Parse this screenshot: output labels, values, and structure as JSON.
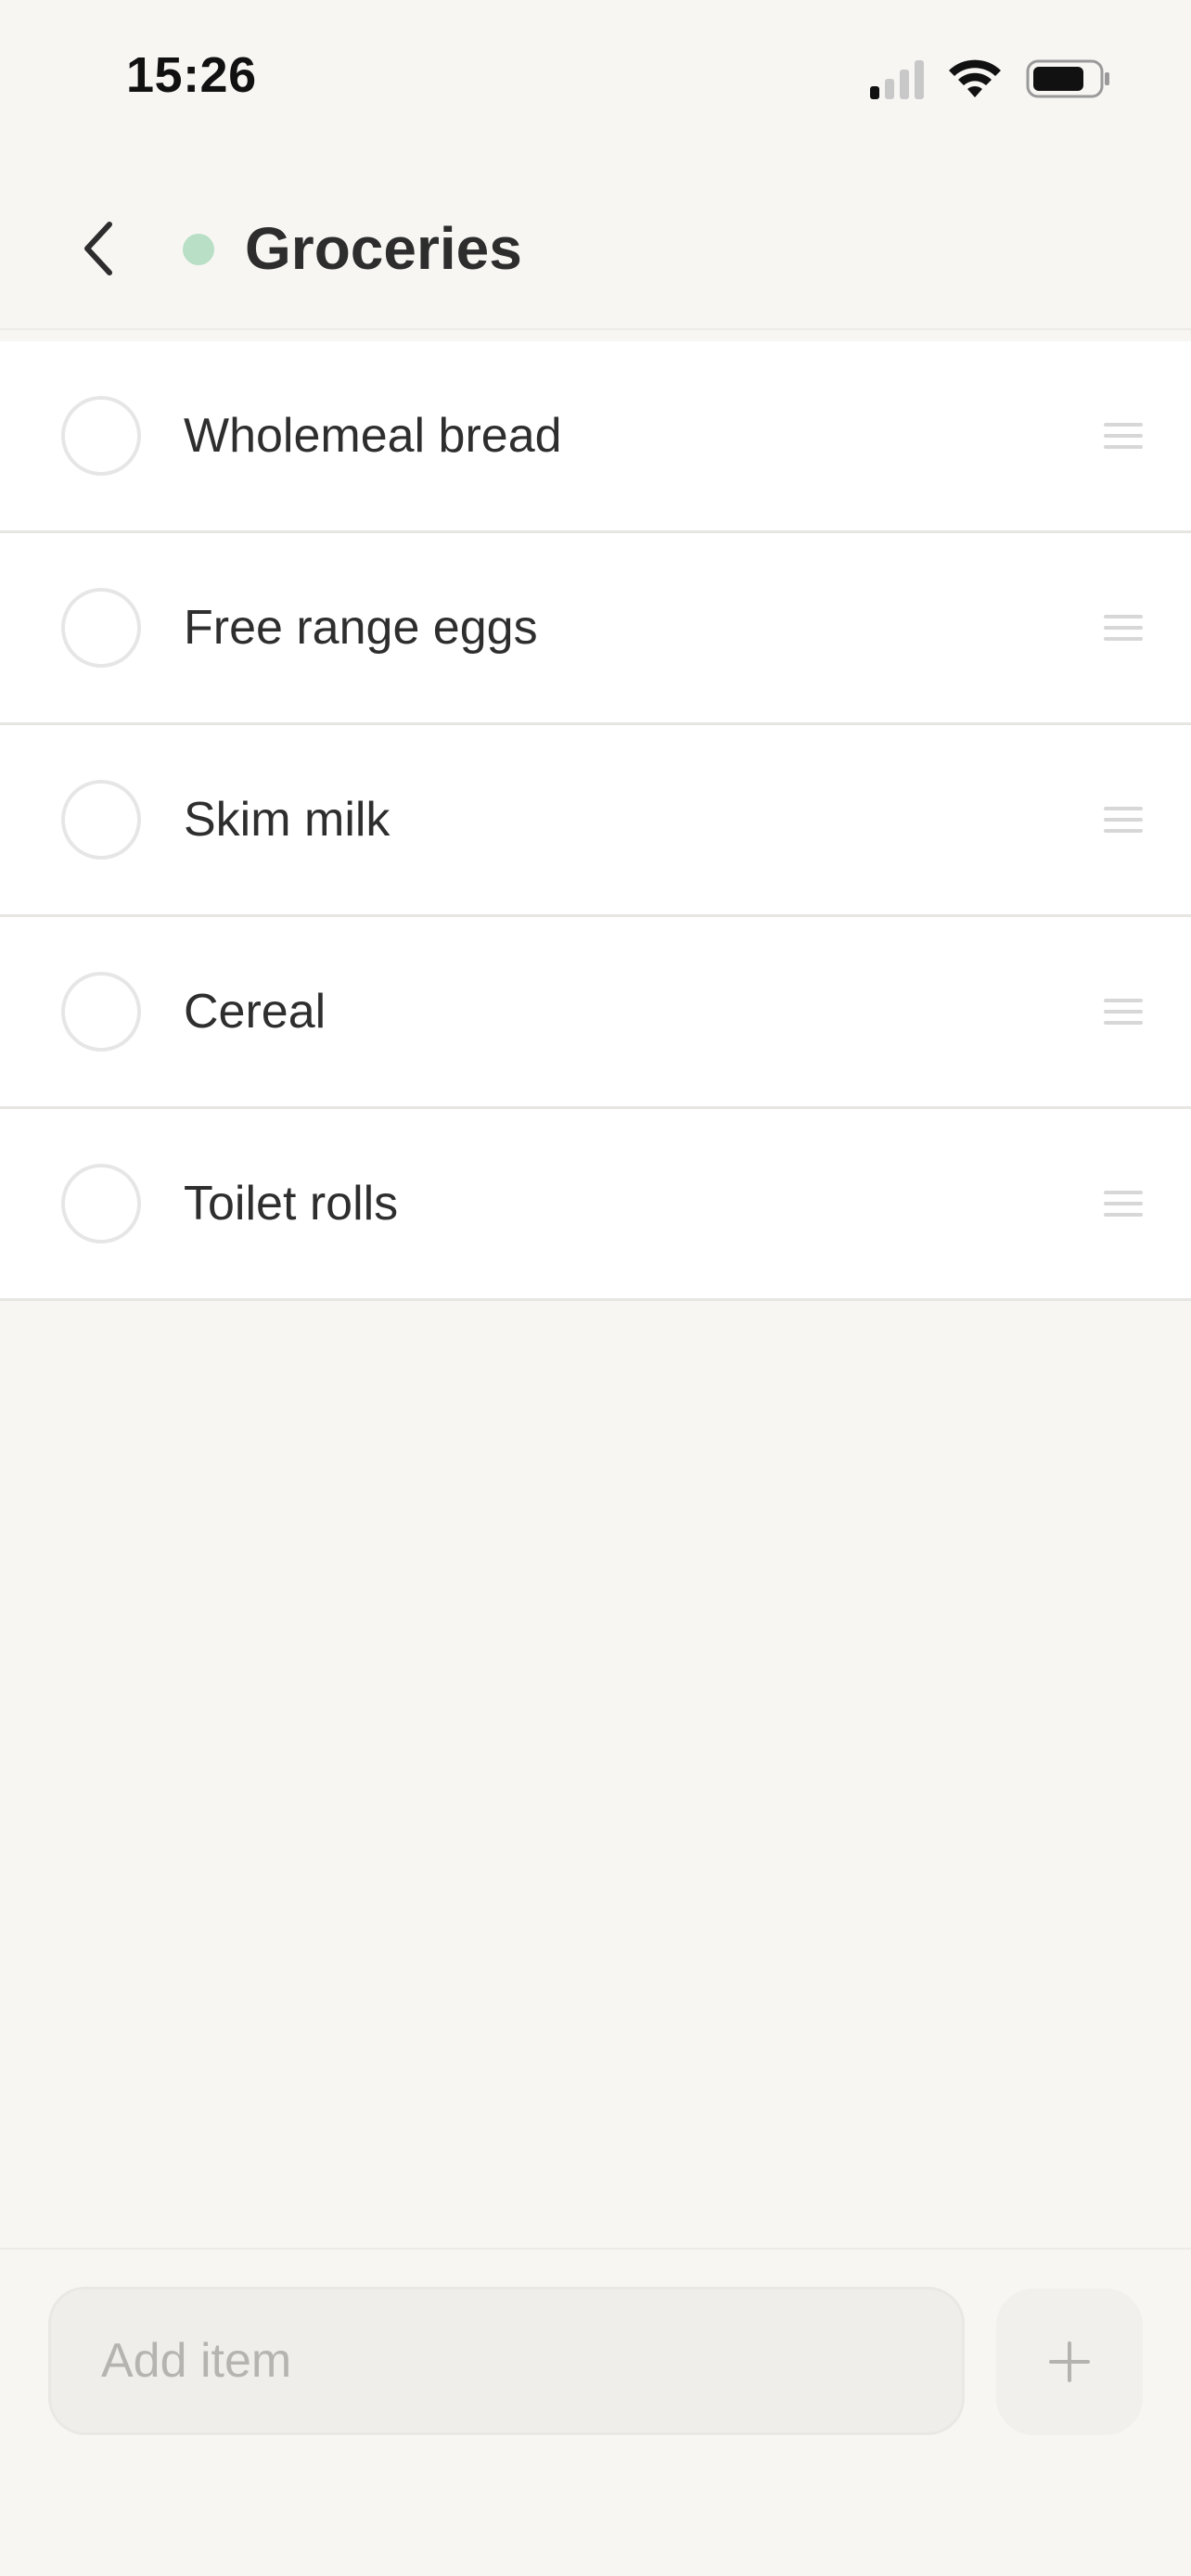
{
  "status_bar": {
    "time": "15:26",
    "icons": [
      "cellular-signal-icon",
      "wifi-icon",
      "battery-icon"
    ]
  },
  "header": {
    "back_icon": "chevron-left-icon",
    "title": "Groceries",
    "dot_color": "#b9dfc6"
  },
  "items": [
    {
      "label": "Wholemeal bread",
      "checked": false
    },
    {
      "label": "Free range eggs",
      "checked": false
    },
    {
      "label": "Skim milk",
      "checked": false
    },
    {
      "label": "Cereal",
      "checked": false
    },
    {
      "label": "Toilet rolls",
      "checked": false
    }
  ],
  "footer": {
    "add_placeholder": "Add item",
    "add_button_icon": "plus-icon"
  },
  "colors": {
    "background": "#f7f6f3",
    "list_background": "#ffffff",
    "text": "#2e2e2e",
    "accent_dot": "#b9dfc6"
  }
}
